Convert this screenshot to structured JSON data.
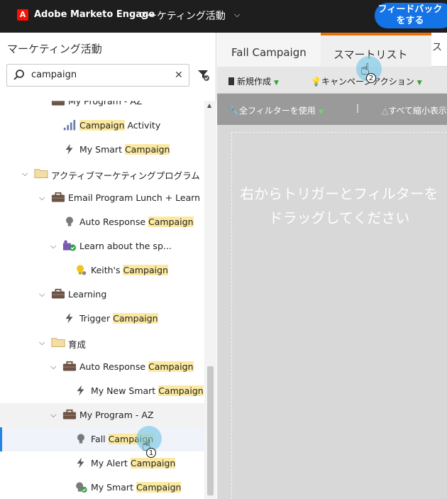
{
  "topbar": {
    "logo_letter": "A",
    "app_name": "Adobe Marketo Engage",
    "workspace": "マーケティング活動",
    "feedback_button": "フィードバックをする"
  },
  "left_panel": {
    "title": "マーケティング活動",
    "search": {
      "value": "campaign",
      "placeholder": ""
    }
  },
  "tree": [
    {
      "label_before": "My Program - AZ",
      "match": "",
      "label_after": "",
      "icon": "program-icon",
      "indent": 1,
      "chevron": ""
    },
    {
      "label_before": "",
      "match": "Campaign",
      "label_after": " Activity",
      "icon": "report-bar-icon",
      "indent": 2,
      "chevron": ""
    },
    {
      "label_before": "My Smart ",
      "match": "Campaign",
      "label_after": "",
      "icon": "lightning-icon",
      "indent": 2,
      "chevron": ""
    },
    {
      "label_before": "アクティブマーケティングプログラム",
      "match": "",
      "label_after": "",
      "icon": "folder-icon",
      "indent": 0,
      "chevron": "down"
    },
    {
      "label_before": "Email Program Lunch + Learn",
      "match": "",
      "label_after": "",
      "icon": "program-icon",
      "indent": 1,
      "chevron": "down"
    },
    {
      "label_before": "Auto Response ",
      "match": "Campaign",
      "label_after": "",
      "icon": "lightbulb-icon",
      "indent": 2,
      "chevron": ""
    },
    {
      "label_before": "Learn about the sp...",
      "match": "",
      "label_after": "",
      "icon": "event-program-icon",
      "indent": 2,
      "chevron": "down"
    },
    {
      "label_before": "Keith's ",
      "match": "Campaign",
      "label_after": "",
      "icon": "lightbulb-gear-icon",
      "indent": 3,
      "chevron": ""
    },
    {
      "label_before": "Learning",
      "match": "",
      "label_after": "",
      "icon": "program-icon",
      "indent": 1,
      "chevron": "down"
    },
    {
      "label_before": "Trigger ",
      "match": "Campaign",
      "label_after": "",
      "icon": "lightning-icon",
      "indent": 2,
      "chevron": ""
    },
    {
      "label_before": "育成",
      "match": "",
      "label_after": "",
      "icon": "folder-icon",
      "indent": 1,
      "chevron": "down"
    },
    {
      "label_before": "Auto Response ",
      "match": "Campaign",
      "label_after": "",
      "icon": "program-icon",
      "indent": 2,
      "chevron": "down"
    },
    {
      "label_before": "My New Smart ",
      "match": "Campaign",
      "label_after": "",
      "icon": "lightning-icon",
      "indent": 3,
      "chevron": ""
    },
    {
      "label_before": "My Program - AZ",
      "match": "",
      "label_after": "",
      "icon": "program-icon",
      "indent": 2,
      "chevron": "down"
    },
    {
      "label_before": "Fall ",
      "match": "Campaign",
      "label_after": "",
      "icon": "lightbulb-icon",
      "indent": 3,
      "chevron": ""
    },
    {
      "label_before": "My Alert ",
      "match": "Campaign",
      "label_after": "",
      "icon": "lightning-icon",
      "indent": 3,
      "chevron": ""
    },
    {
      "label_before": "My Smart ",
      "match": "Campaign",
      "label_after": "",
      "icon": "lightbulb-check-icon",
      "indent": 3,
      "chevron": ""
    }
  ],
  "tabs": {
    "tab1": "Fall Campaign",
    "tab2": "スマートリスト",
    "tab3": "ス"
  },
  "toolbar": {
    "new_label": "新規作成",
    "campaign_action_label": "キャンペーンアクション",
    "use_all_filters_label": "全フィルターを使用",
    "separator": "|",
    "collapse_all_label": "すべて縮小表示"
  },
  "canvas": {
    "line1": "右からトリガーとフィルターを",
    "line2": "ドラッグしてください"
  },
  "markers": {
    "step1": "1",
    "step2": "2"
  },
  "colors": {
    "accent_blue": "#2680eb",
    "highlight": "#fbe9a2",
    "tab_orange": "#e5730c",
    "adobe_red": "#fa0f00"
  }
}
